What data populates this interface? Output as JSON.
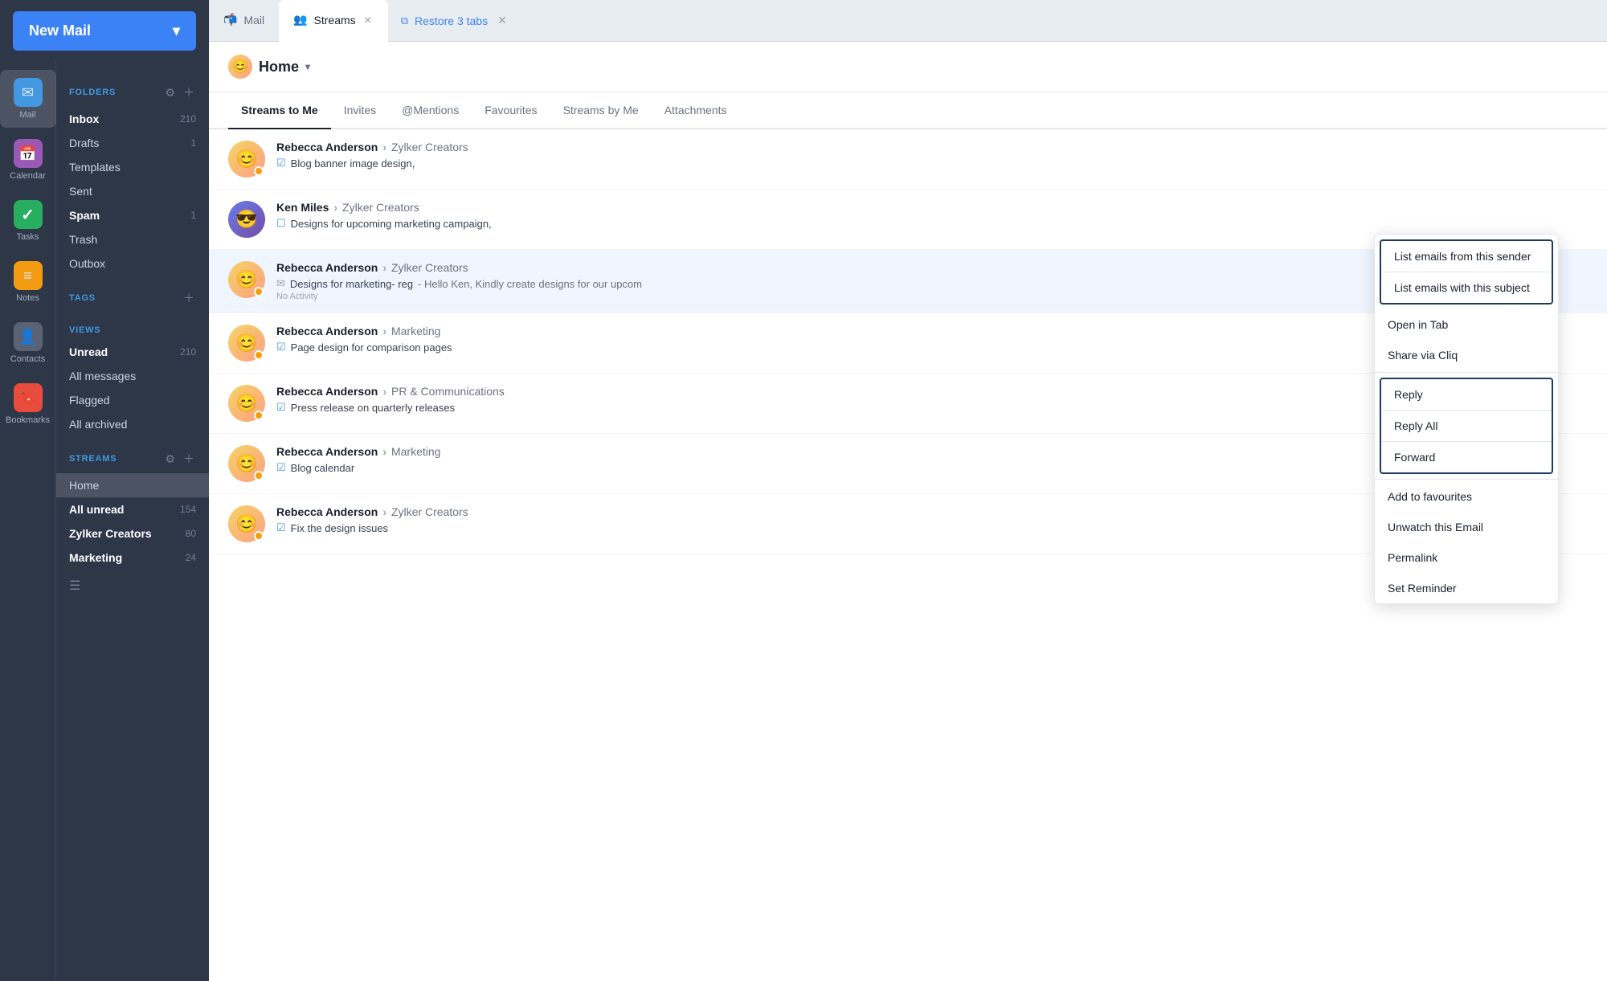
{
  "sidebar": {
    "new_mail_label": "New Mail",
    "nav_items": [
      {
        "id": "mail",
        "label": "Mail",
        "icon": "✉",
        "color": "icon-mail",
        "active": true
      },
      {
        "id": "calendar",
        "label": "Calendar",
        "icon": "📅",
        "color": "icon-calendar",
        "active": false
      },
      {
        "id": "tasks",
        "label": "Tasks",
        "icon": "✓",
        "color": "icon-tasks",
        "active": false
      },
      {
        "id": "notes",
        "label": "Notes",
        "icon": "📝",
        "color": "icon-notes",
        "active": false
      },
      {
        "id": "contacts",
        "label": "Contacts",
        "icon": "👤",
        "color": "icon-contacts",
        "active": false
      },
      {
        "id": "bookmarks",
        "label": "Bookmarks",
        "icon": "🔖",
        "color": "icon-bookmarks",
        "active": false
      }
    ],
    "folders_title": "FOLDERS",
    "folders": [
      {
        "name": "Inbox",
        "count": "210",
        "bold": true
      },
      {
        "name": "Drafts",
        "count": "1",
        "bold": false
      },
      {
        "name": "Templates",
        "count": "",
        "bold": false
      },
      {
        "name": "Sent",
        "count": "",
        "bold": false
      },
      {
        "name": "Spam",
        "count": "1",
        "bold": true
      },
      {
        "name": "Trash",
        "count": "",
        "bold": false
      },
      {
        "name": "Outbox",
        "count": "",
        "bold": false
      }
    ],
    "tags_title": "TAGS",
    "views_title": "VIEWS",
    "views": [
      {
        "name": "Unread",
        "count": "210",
        "bold": true
      },
      {
        "name": "All messages",
        "count": "",
        "bold": false
      },
      {
        "name": "Flagged",
        "count": "",
        "bold": false
      },
      {
        "name": "All archived",
        "count": "",
        "bold": false
      }
    ],
    "streams_title": "STREAMS",
    "streams": [
      {
        "name": "Home",
        "count": "",
        "bold": false,
        "active": true
      },
      {
        "name": "All unread",
        "count": "154",
        "bold": true
      },
      {
        "name": "Zylker Creators",
        "count": "80",
        "bold": true
      },
      {
        "name": "Marketing",
        "count": "24",
        "bold": true
      }
    ]
  },
  "tabs": {
    "mail_label": "Mail",
    "streams_label": "Streams",
    "restore_label": "Restore 3 tabs"
  },
  "content": {
    "home_label": "Home",
    "stream_tabs": [
      {
        "label": "Streams to Me",
        "active": true
      },
      {
        "label": "Invites",
        "active": false
      },
      {
        "label": "@Mentions",
        "active": false
      },
      {
        "label": "Favourites",
        "active": false
      },
      {
        "label": "Streams by Me",
        "active": false
      },
      {
        "label": "Attachments",
        "active": false
      }
    ],
    "emails": [
      {
        "sender": "Rebecca Anderson",
        "channel": "Zylker Creators",
        "subject": "Blog banner image design,",
        "preview": "",
        "meta": "",
        "has_dot": true,
        "avatar_type": "rebecca"
      },
      {
        "sender": "Ken Miles",
        "channel": "Zylker Creators",
        "subject": "Designs for upcoming marketing campaign,",
        "preview": "",
        "meta": "",
        "has_dot": false,
        "avatar_type": "ken"
      },
      {
        "sender": "Rebecca Anderson",
        "channel": "Zylker Creators",
        "subject": "Designs for marketing- reg",
        "preview": "Hello Ken, Kindly create designs for our upcom",
        "meta": "No Activity",
        "has_dot": true,
        "avatar_type": "rebecca",
        "selected": true
      },
      {
        "sender": "Rebecca Anderson",
        "channel": "Marketing",
        "subject": "Page design for comparison pages",
        "preview": "",
        "meta": "",
        "has_dot": true,
        "avatar_type": "rebecca"
      },
      {
        "sender": "Rebecca Anderson",
        "channel": "PR & Communications",
        "subject": "Press release on quarterly releases",
        "preview": "",
        "meta": "",
        "has_dot": true,
        "avatar_type": "rebecca"
      },
      {
        "sender": "Rebecca Anderson",
        "channel": "Marketing",
        "subject": "Blog calendar",
        "preview": "",
        "meta": "",
        "has_dot": true,
        "avatar_type": "rebecca"
      },
      {
        "sender": "Rebecca Anderson",
        "channel": "Zylker Creators",
        "subject": "Fix the design issues",
        "preview": "",
        "meta": "",
        "has_dot": true,
        "avatar_type": "rebecca"
      }
    ]
  },
  "context_menu": {
    "group1": [
      {
        "label": "List emails from this sender"
      },
      {
        "label": "List emails with this subject"
      }
    ],
    "standalone1": {
      "label": "Open in Tab"
    },
    "standalone2": {
      "label": "Share via Cliq"
    },
    "group2": [
      {
        "label": "Reply"
      },
      {
        "label": "Reply All"
      },
      {
        "label": "Forward"
      }
    ],
    "standalone3": {
      "label": "Add to favourites"
    },
    "standalone4": {
      "label": "Unwatch this Email"
    },
    "standalone5": {
      "label": "Permalink"
    },
    "standalone6": {
      "label": "Set Reminder"
    }
  }
}
